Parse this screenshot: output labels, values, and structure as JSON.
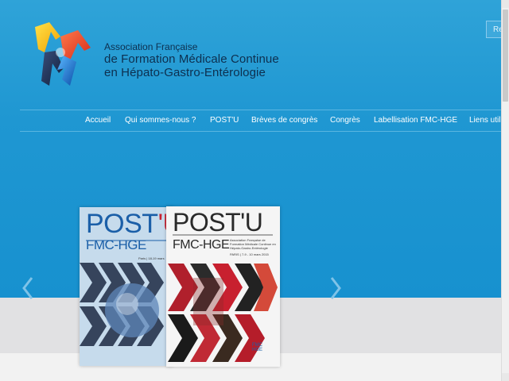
{
  "header": {
    "association_line1": "Association Française",
    "association_line2": "de Formation Médicale Continue",
    "association_line3": "en Hépato-Gastro-Entérologie",
    "right_button_label": "Re"
  },
  "nav": {
    "items": [
      {
        "label": "Accueil"
      },
      {
        "label": "Qui sommes-nous ?"
      },
      {
        "label": "POST'U"
      },
      {
        "label": "Brèves de congrès"
      },
      {
        "label": "Congrès"
      },
      {
        "label": "Labellisation FMC-HGE"
      },
      {
        "label": "Liens util"
      }
    ]
  },
  "slider": {
    "prev_icon": "chevron-left-icon",
    "next_icon": "chevron-right-icon",
    "book_back": {
      "title_a": "POST",
      "title_b": "'U",
      "subtitle": "FMC-HGE",
      "small_text": "Paris | 18-19 mars"
    },
    "book_front": {
      "title": "POST'U",
      "subtitle": "FMC-HGE",
      "assoc_text": "Association Française de Formation Médicale Continue en Hépato-Gastro-Entérologie",
      "date_text": "PARIS | 7-9 - 10 mars 2015",
      "badge_line1": "FMC",
      "badge_line2": "HGE"
    }
  },
  "colors": {
    "hero": "#1f97d2",
    "nav_text": "#ffffff",
    "title_dark": "#0d2f4f",
    "accent_red": "#c8202f",
    "band_grey": "#e1e1e3"
  }
}
